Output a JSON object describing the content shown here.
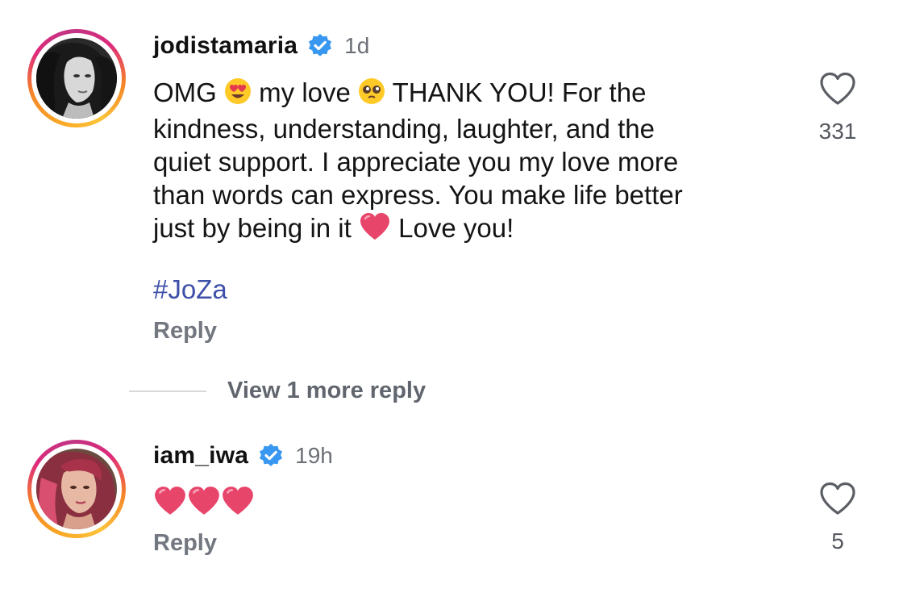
{
  "comments": [
    {
      "username": "jodistamaria",
      "time": "1d",
      "text_parts": [
        "OMG ",
        " my love ",
        " THANK YOU! For the\nkindness, understanding, laughter, and the\nquiet support. I appreciate you my love more\nthan words can express. You make life better\njust by being in it ",
        " Love you!"
      ],
      "emojis": [
        "heart-eyes-emoji",
        "pleading-face-emoji",
        "red-heart-emoji"
      ],
      "hashtag": "#JoZa",
      "reply_label": "Reply",
      "like_count": "331",
      "verified": true
    },
    {
      "username": "iam_iwa",
      "time": "19h",
      "emojis": [
        "red-heart-emoji",
        "red-heart-emoji",
        "red-heart-emoji"
      ],
      "reply_label": "Reply",
      "like_count": "5",
      "verified": true
    }
  ],
  "view_more_replies": "View 1 more reply",
  "colors": {
    "hashtag": "#3d4fa8",
    "verified": "#3897f0",
    "secondary_text": "#737780",
    "heart": "#e8456b"
  }
}
